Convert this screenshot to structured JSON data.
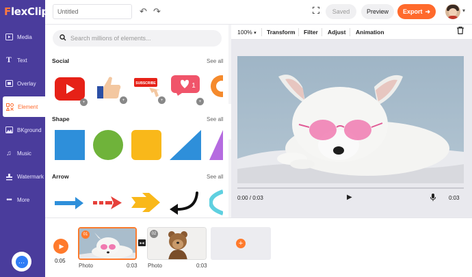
{
  "app": {
    "logo_text": "lexClip",
    "logo_f": "F"
  },
  "sidebar": {
    "items": [
      {
        "label": "Media",
        "icon": "media-icon"
      },
      {
        "label": "Text",
        "icon": "text-icon"
      },
      {
        "label": "Overlay",
        "icon": "overlay-icon"
      },
      {
        "label": "Element",
        "icon": "element-icon"
      },
      {
        "label": "BKground",
        "icon": "background-icon"
      },
      {
        "label": "Music",
        "icon": "music-icon"
      },
      {
        "label": "Watermark",
        "icon": "watermark-icon"
      },
      {
        "label": "More",
        "icon": "more-icon"
      }
    ],
    "active": "Element"
  },
  "topbar": {
    "title_value": "Untitled",
    "saved_label": "Saved",
    "preview_label": "Preview",
    "export_label": "Export"
  },
  "panel": {
    "search_placeholder": "Search millions of elements...",
    "sections": {
      "social": {
        "title": "Social",
        "see_all": "See all"
      },
      "shape": {
        "title": "Shape",
        "see_all": "See all"
      },
      "arrow": {
        "title": "Arrow",
        "see_all": "See all"
      }
    },
    "social_items": {
      "subscribe_text": "SUBSCRIBE",
      "like_count": "1"
    }
  },
  "stage_toolbar": {
    "zoom": "100%",
    "items": [
      "Transform",
      "Filter",
      "Adjust",
      "Animation"
    ]
  },
  "player": {
    "current_time": "0:00 / 0:03",
    "duration": "0:03"
  },
  "timeline": {
    "total_time": "0:05",
    "clips": [
      {
        "num": "01",
        "label": "Photo",
        "duration": "0:03"
      },
      {
        "num": "02",
        "label": "Photo",
        "duration": "0:03"
      }
    ]
  },
  "colors": {
    "sidebar": "#4a3c9c",
    "accent": "#ff6a2c"
  }
}
